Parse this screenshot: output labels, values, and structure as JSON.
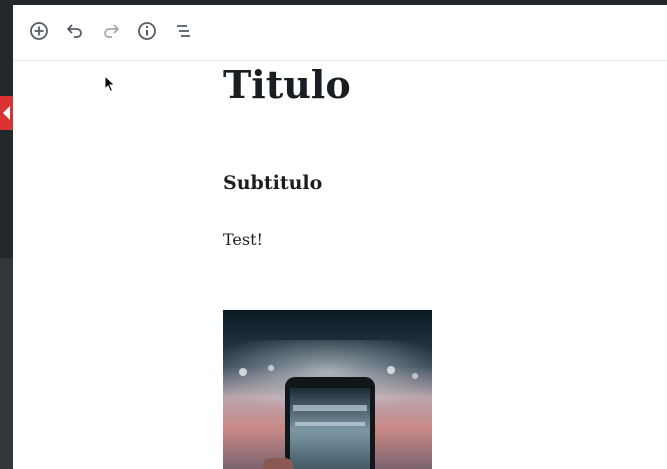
{
  "toolbar": {
    "buttons": [
      {
        "name": "add-block-button",
        "icon": "plus-circle-icon"
      },
      {
        "name": "undo-button",
        "icon": "undo-icon"
      },
      {
        "name": "redo-button",
        "icon": "redo-icon",
        "disabled": true
      },
      {
        "name": "info-button",
        "icon": "info-icon"
      },
      {
        "name": "outline-button",
        "icon": "list-icon"
      }
    ]
  },
  "content": {
    "title": "Titulo",
    "subtitle": "Subtitulo",
    "paragraph": "Test!",
    "image": {
      "subject": "phone-photo-of-stadium"
    }
  },
  "colors": {
    "text": "#191e23",
    "sidebar": "#23282d",
    "collapse_tab": "#dc3232",
    "icon": "#555d66",
    "icon_disabled": "#a2aab2"
  }
}
